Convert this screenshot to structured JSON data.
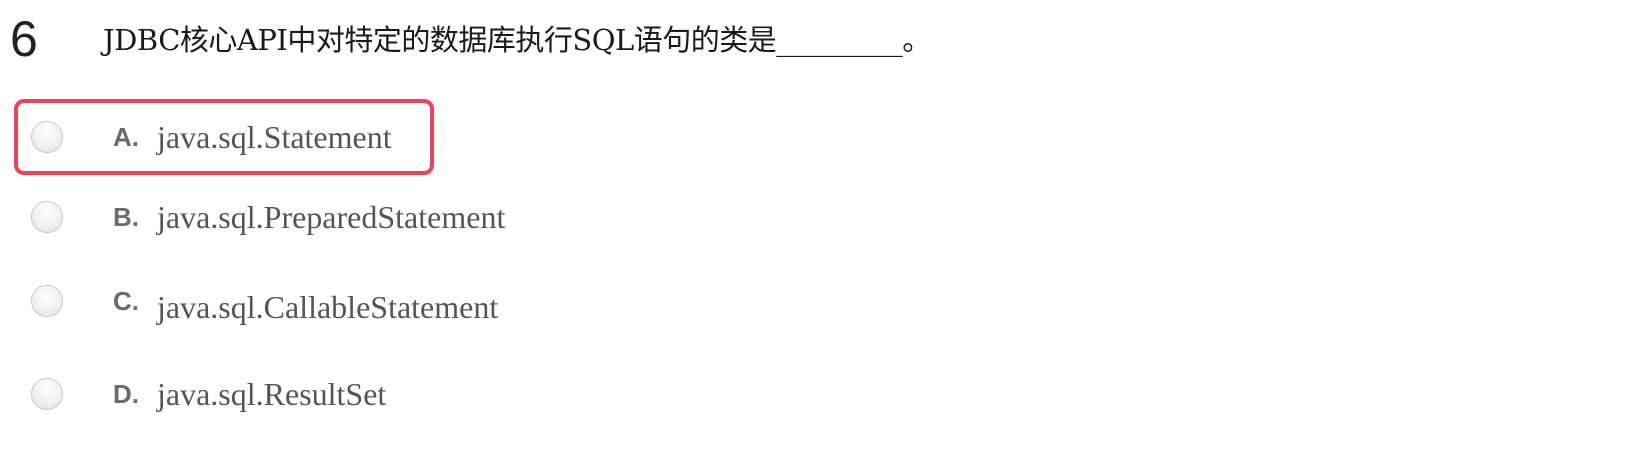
{
  "question": {
    "number": "6",
    "text": "JDBC核心API中对特定的数据库执行SQL语句的类是_________。"
  },
  "options": [
    {
      "letter": "A.",
      "text": "java.sql.Statement",
      "selected": true
    },
    {
      "letter": "B.",
      "text": "java.sql.PreparedStatement",
      "selected": false
    },
    {
      "letter": "C.",
      "text": "java.sql.CallableStatement",
      "selected": false
    },
    {
      "letter": "D.",
      "text": "java.sql.ResultSet",
      "selected": false
    }
  ],
  "colors": {
    "selection_outline": "#f0435a",
    "option_text": "#555555",
    "question_text": "#1a1a1a"
  }
}
